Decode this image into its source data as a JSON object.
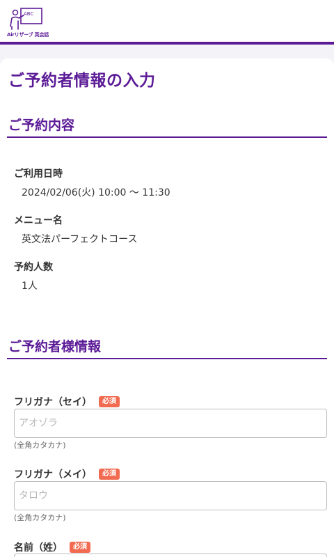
{
  "header": {
    "logo_text": "Airリザーブ 英会話",
    "logo_board_text": "ABC"
  },
  "page_title": "ご予約者情報の入力",
  "reservation": {
    "section_title": "ご予約内容",
    "datetime_label": "ご利用日時",
    "datetime_value": "2024/02/06(火) 10:00 〜 11:30",
    "menu_label": "メニュー名",
    "menu_value": "英文法パーフェクトコース",
    "people_label": "予約人数",
    "people_value": "1人"
  },
  "customer": {
    "section_title": "ご予約者様情報",
    "required_badge": "必須",
    "furigana_sei_label": "フリガナ（セイ）",
    "furigana_sei_placeholder": "アオゾラ",
    "furigana_sei_value": "",
    "furigana_sei_hint": "(全角カタカナ)",
    "furigana_mei_label": "フリガナ（メイ）",
    "furigana_mei_placeholder": "タロウ",
    "furigana_mei_value": "",
    "furigana_mei_hint": "(全角カタカナ)",
    "name_sei_label": "名前（姓）"
  },
  "colors": {
    "brand": "#5b1a96",
    "required": "#f26a4f"
  }
}
